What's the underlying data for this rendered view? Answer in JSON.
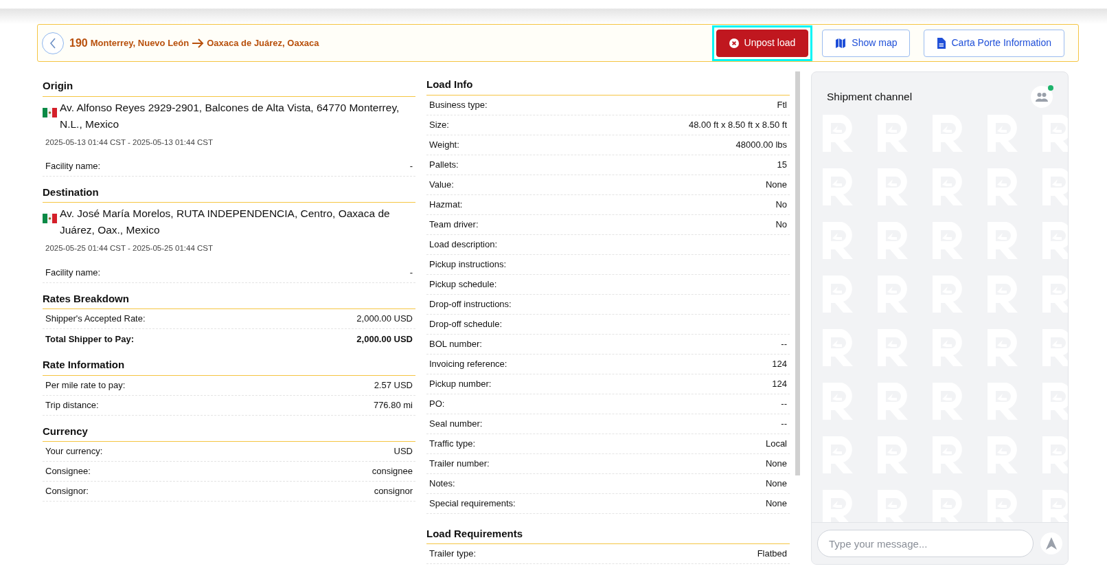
{
  "header": {
    "number": "190",
    "origin": "Monterrey, Nuevo León",
    "destination": "Oaxaca de Juárez, Oaxaca"
  },
  "actions": [
    {
      "kind": "unpost",
      "label": "Unpost load",
      "focused": true
    },
    {
      "kind": "map",
      "label": "Show map"
    },
    {
      "kind": "document",
      "label": "Carta Porte Information"
    }
  ],
  "left_sections": [
    {
      "kind": "stop",
      "title": "Origin",
      "address": "Av. Alfonso Reyes 2929-2901, Balcones de Alta Vista, 64770 Monterrey, N.L., Mexico",
      "time": "2025-05-13 01:44 CST - 2025-05-13 01:44 CST",
      "rows": [
        {
          "label": "Facility name:",
          "value": "-"
        }
      ]
    },
    {
      "kind": "stop",
      "title": "Destination",
      "address": "Av. José María Morelos, RUTA INDEPENDENCIA, Centro, Oaxaca de Juárez, Oax., Mexico",
      "time": "2025-05-25 01:44 CST - 2025-05-25 01:44 CST",
      "rows": [
        {
          "label": "Facility name:",
          "value": "-"
        }
      ]
    },
    {
      "kind": "table",
      "title": "Rates Breakdown",
      "rows": [
        {
          "label": "Shipper's Accepted Rate:",
          "value": "2,000.00 USD",
          "total": false
        },
        {
          "label": "Total Shipper to Pay:",
          "value": "2,000.00 USD",
          "total": true
        }
      ]
    },
    {
      "kind": "table",
      "title": "Rate Information",
      "rows": [
        {
          "label": "Per mile rate to pay:",
          "value": "2.57 USD"
        },
        {
          "label": "Trip distance:",
          "value": "776.80 mi"
        }
      ]
    },
    {
      "kind": "table",
      "title": "Currency",
      "rows": [
        {
          "label": "Your currency:",
          "value": "USD"
        },
        {
          "label": "Consignee:",
          "value": "consignee"
        },
        {
          "label": "Consignor:",
          "value": "consignor"
        }
      ]
    }
  ],
  "middle_sections": [
    {
      "title": "Load Info",
      "rows": [
        {
          "label": "Business type:",
          "value": "Ftl"
        },
        {
          "label": "Size:",
          "value": "48.00 ft x 8.50 ft x 8.50 ft"
        },
        {
          "label": "Weight:",
          "value": "48000.00 lbs"
        },
        {
          "label": "Pallets:",
          "value": "15"
        },
        {
          "label": "Value:",
          "value": "None"
        },
        {
          "label": "Hazmat:",
          "value": "No"
        },
        {
          "label": "Team driver:",
          "value": "No"
        },
        {
          "label": "Load description:"
        },
        {
          "label": "Pickup instructions:"
        },
        {
          "label": "Pickup schedule:"
        },
        {
          "label": "Drop-off instructions:"
        },
        {
          "label": "Drop-off schedule:"
        },
        {
          "label": "BOL number:",
          "value": "--"
        },
        {
          "label": "Invoicing reference:",
          "value": "124"
        },
        {
          "label": "Pickup number:",
          "value": "124"
        },
        {
          "label": "PO:",
          "value": "--"
        },
        {
          "label": "Seal number:",
          "value": "--"
        },
        {
          "label": "Traffic type:",
          "value": "Local"
        },
        {
          "label": "Trailer number:",
          "value": "None"
        },
        {
          "label": "Notes:",
          "value": "None"
        },
        {
          "label": "Special requirements:",
          "value": "None"
        }
      ]
    },
    {
      "title": "Load Requirements",
      "rows": [
        {
          "label": "Trailer type:",
          "value": "Flatbed"
        }
      ]
    }
  ],
  "chat": {
    "title": "Shipment channel",
    "online": true,
    "placeholder": "Type your message..."
  }
}
